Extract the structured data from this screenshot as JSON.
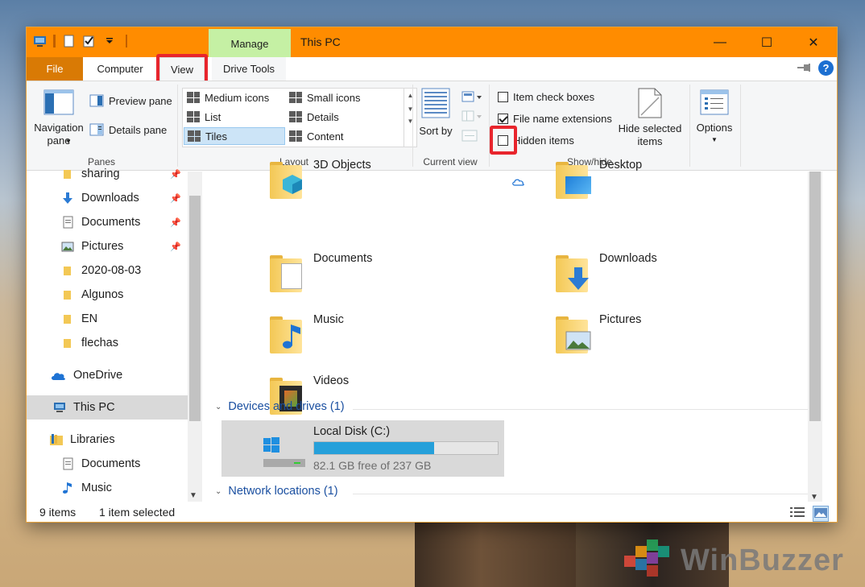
{
  "window": {
    "title": "This PC",
    "contextual_tab_group": "Manage",
    "controls": {
      "minimize": "—",
      "maximize": "☐",
      "close": "✕"
    }
  },
  "ribbon_tabs": [
    {
      "label": "File"
    },
    {
      "label": "Computer"
    },
    {
      "label": "View"
    },
    {
      "label": "Drive Tools"
    }
  ],
  "ribbon": {
    "panes": {
      "label": "Panes",
      "navigation_pane": "Navigation pane",
      "preview_pane": "Preview pane",
      "details_pane": "Details pane"
    },
    "layout": {
      "label": "Layout",
      "items": [
        "Medium icons",
        "Small icons",
        "List",
        "Details",
        "Tiles",
        "Content"
      ],
      "selected": "Tiles"
    },
    "current_view": {
      "label": "Current view",
      "sort_by": "Sort by"
    },
    "show_hide": {
      "label": "Show/hide",
      "item_check_boxes": {
        "label": "Item check boxes",
        "checked": false
      },
      "file_name_extensions": {
        "label": "File name extensions",
        "checked": true
      },
      "hidden_items": {
        "label": "Hidden items",
        "checked": false
      },
      "hide_selected_items": "Hide selected items"
    },
    "options": "Options"
  },
  "nav": {
    "items": [
      {
        "label": "sharing",
        "pinned": true
      },
      {
        "label": "Downloads",
        "pinned": true
      },
      {
        "label": "Documents",
        "pinned": true
      },
      {
        "label": "Pictures",
        "pinned": true
      },
      {
        "label": "2020-08-03"
      },
      {
        "label": "Algunos"
      },
      {
        "label": "EN"
      },
      {
        "label": "flechas"
      },
      {
        "label": "OneDrive"
      },
      {
        "label": "This PC"
      },
      {
        "label": "Libraries"
      },
      {
        "label": "Documents"
      },
      {
        "label": "Music"
      }
    ]
  },
  "folders": [
    {
      "label": "3D Objects"
    },
    {
      "label": "Desktop"
    },
    {
      "label": "Documents"
    },
    {
      "label": "Downloads"
    },
    {
      "label": "Music"
    },
    {
      "label": "Pictures"
    },
    {
      "label": "Videos"
    }
  ],
  "sections": {
    "devices": "Devices and drives (1)",
    "network": "Network locations (1)"
  },
  "drive": {
    "name": "Local Disk (C:)",
    "free_text": "82.1 GB free of 237 GB",
    "used_fraction": 0.654
  },
  "status": {
    "item_count": "9 items",
    "selection": "1 item selected"
  },
  "watermark": "WinBuzzer",
  "colors": {
    "titlebar": "#ff8c00",
    "file_tab": "#d97a05",
    "manage_tab": "#c5f0a4",
    "highlight": "#e8252d",
    "drive_fill": "#26a0da",
    "link_blue": "#1a4fa0"
  }
}
